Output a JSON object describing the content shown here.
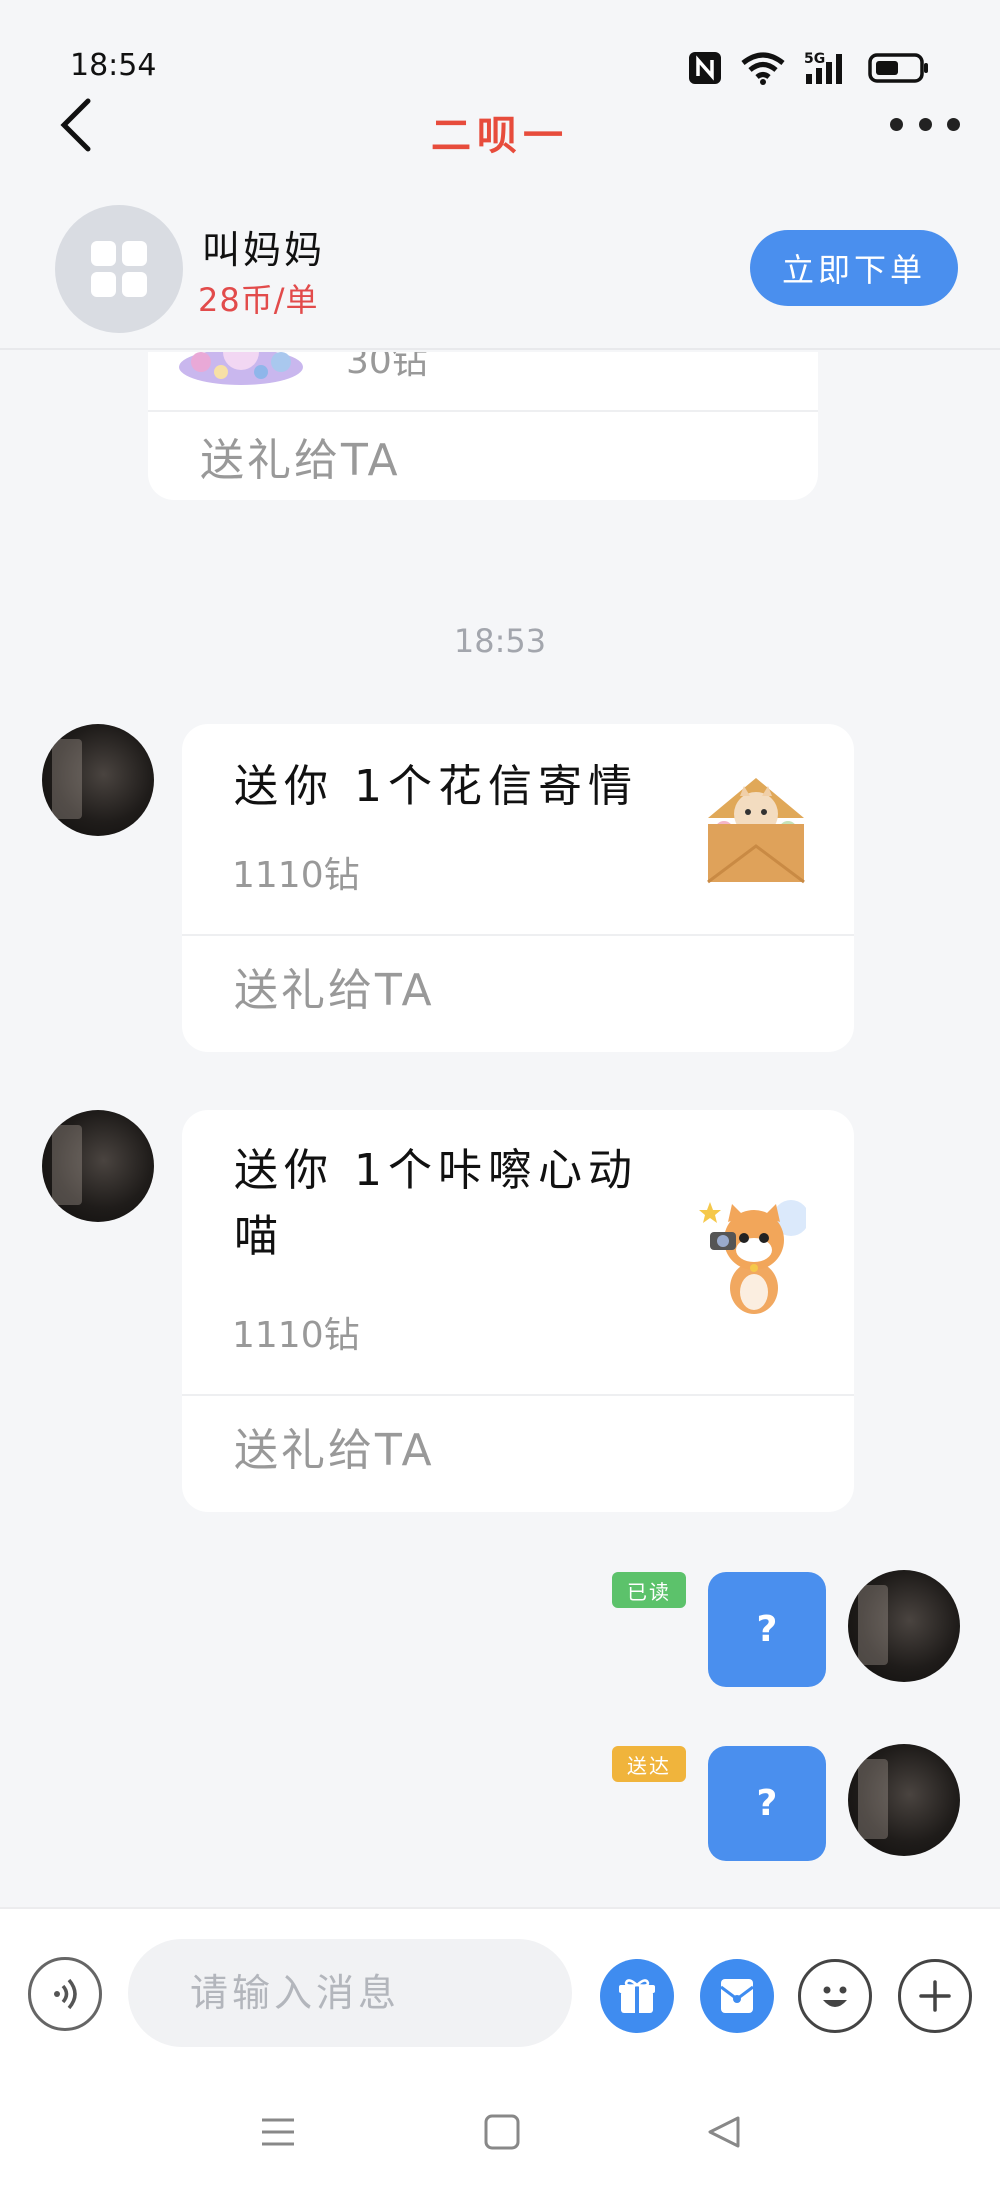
{
  "status_bar": {
    "time": "18:54",
    "network": "5G"
  },
  "nav": {
    "title": "二呗一"
  },
  "service": {
    "name": "叫妈妈",
    "price": "28币/单",
    "order_label": "立即下单"
  },
  "chat": {
    "partial_card": {
      "price": "30钻",
      "action": "送礼给TA"
    },
    "timestamp": "18:53",
    "gift_cards": [
      {
        "title": "送你 1个花信寄情",
        "price": "1110钻",
        "action": "送礼给TA",
        "image": "envelope-cat-gift"
      },
      {
        "title_line1": "送你 1个咔嚓心动",
        "title_line2": "喵",
        "price": "1110钻",
        "action": "送礼给TA",
        "image": "camera-cat-gift"
      }
    ],
    "own_messages": [
      {
        "text": "?",
        "status": "已读",
        "status_color": "#5cc26b"
      },
      {
        "text": "?",
        "status": "送达",
        "status_color": "#f0b43c"
      }
    ]
  },
  "input": {
    "placeholder": "请输入消息"
  },
  "icons": [
    "back-icon",
    "more-icon",
    "voice-icon",
    "gift-icon",
    "red-packet-icon",
    "emoji-icon",
    "plus-icon",
    "menu-icon",
    "home-icon",
    "back-triangle-icon"
  ],
  "colors": {
    "accent": "#4a8fee",
    "title": "#e74c3c",
    "price": "#e24b4b"
  }
}
